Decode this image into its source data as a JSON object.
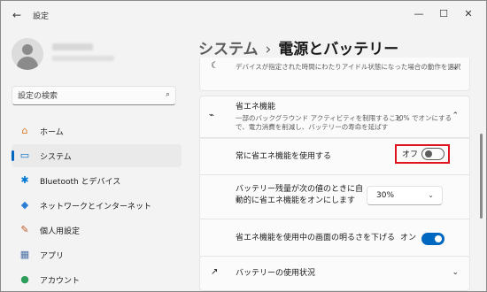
{
  "window": {
    "title": "設定",
    "back_glyph": "←",
    "minimize": "—",
    "maximize": "☐",
    "close": "✕"
  },
  "search": {
    "placeholder": "設定の検索",
    "icon": "search-icon"
  },
  "nav": {
    "items": [
      {
        "label": "ホーム",
        "icon": "home-icon",
        "glyph": "⌂",
        "color": "#d97b2b",
        "active": false
      },
      {
        "label": "システム",
        "icon": "monitor-icon",
        "glyph": "▭",
        "color": "#0067c0",
        "active": true
      },
      {
        "label": "Bluetooth とデバイス",
        "icon": "bluetooth-icon",
        "glyph": "✱",
        "color": "#0078d4",
        "active": false
      },
      {
        "label": "ネットワークとインターネット",
        "icon": "wifi-icon",
        "glyph": "◆",
        "color": "#2d7fd3",
        "active": false
      },
      {
        "label": "個人用設定",
        "icon": "brush-icon",
        "glyph": "✎",
        "color": "#c45b2a",
        "active": false
      },
      {
        "label": "アプリ",
        "icon": "apps-icon",
        "glyph": "▦",
        "color": "#4a6fa5",
        "active": false
      },
      {
        "label": "アカウント",
        "icon": "account-icon",
        "glyph": "●",
        "color": "#2e9c5a",
        "active": false
      }
    ]
  },
  "breadcrumb": {
    "parent": "システム",
    "separator": "›",
    "current": "電源とバッテリー"
  },
  "top_card": {
    "text": "デバイスが指定された時間にわたりアイドル状態になった場合の動作を選択"
  },
  "eco": {
    "title": "省エネ機能",
    "desc_line1": "一部のバックグラウンド アクティビティを制限すること",
    "desc_line2": "で、電力消費を削減し、バッテリーの寿命を延ばす",
    "status": "30% でオンにする"
  },
  "settings": {
    "always_on": {
      "label": "常に省エネ機能を使用する",
      "state": "オフ",
      "on": false
    },
    "threshold": {
      "label_line1": "バッテリー残量が次の値のときに自",
      "label_line2": "動的に省エネ機能をオンにします",
      "value": "30%"
    },
    "dim": {
      "label": "省エネ機能を使用中の画面の明るさを下げる",
      "state": "オン",
      "on": true
    }
  },
  "usage": {
    "label": "バッテリーの使用状況"
  },
  "colors": {
    "accent": "#0067c0",
    "highlight": "#e0141e"
  }
}
